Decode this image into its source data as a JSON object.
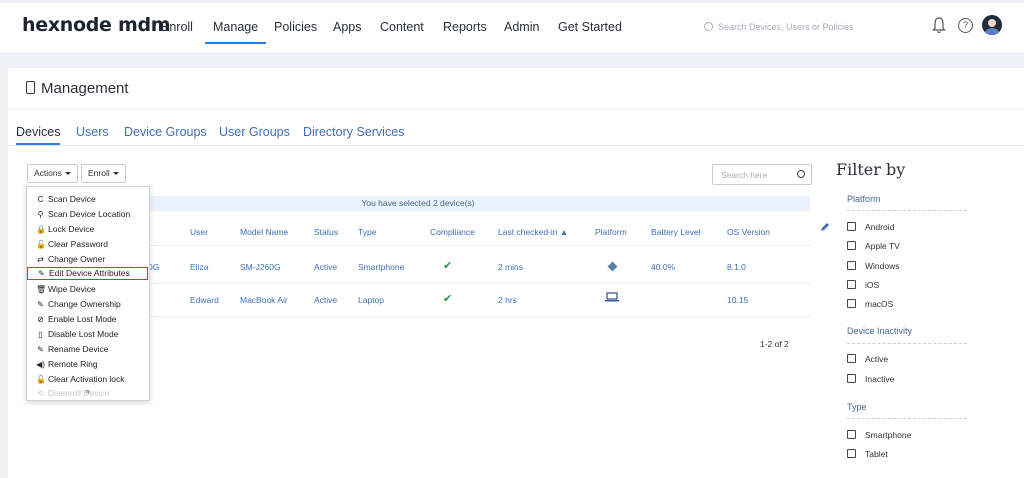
{
  "nav": {
    "logo": "hexnode mdm",
    "items": [
      "Enroll",
      "Manage",
      "Policies",
      "Apps",
      "Content",
      "Reports",
      "Admin",
      "Get Started"
    ],
    "active": "Manage",
    "search_placeholder": "Search Devices, Users or Policies"
  },
  "page": {
    "title": "Management",
    "tabs": [
      "Devices",
      "Users",
      "Device Groups",
      "User Groups",
      "Directory Services"
    ],
    "active_tab": "Devices"
  },
  "toolbar": {
    "actions_label": "Actions",
    "enroll_label": "Enroll",
    "search_placeholder": "Search here"
  },
  "table": {
    "banner": "You have selected 2 device(s)",
    "columns": [
      "User",
      "Model Name",
      "Status",
      "Type",
      "Compliance",
      "Last checked-in ▲",
      "Platform",
      "Battery Level",
      "OS Version"
    ],
    "rows": [
      {
        "name_fragment": "0G",
        "user": "Eliza",
        "model": "SM-J260G",
        "status": "Active",
        "type": "Smartphone",
        "compliance": "✔",
        "last_checked": "2 mins",
        "platform": "android-icon",
        "battery": "40.0%",
        "os": "8.1.0"
      },
      {
        "name_fragment": "",
        "user": "Edward",
        "model": "MacBook Air",
        "status": "Active",
        "type": "Laptop",
        "compliance": "✔",
        "last_checked": "2 hrs",
        "platform": "laptop-icon",
        "battery": "",
        "os": "10.15"
      }
    ],
    "pager": "1-2 of 2"
  },
  "actions_menu": {
    "items": [
      {
        "icon": "C",
        "label": "Scan Device"
      },
      {
        "icon": "⚲",
        "label": "Scan Device Location"
      },
      {
        "icon": "🔒",
        "label": "Lock Device"
      },
      {
        "icon": "🔓",
        "label": "Clear Password"
      },
      {
        "icon": "⇄",
        "label": "Change Owner"
      },
      {
        "icon": "✎",
        "label": "Edit Device Attributes"
      },
      {
        "icon": "🗑",
        "label": "Wipe Device"
      },
      {
        "icon": "✎",
        "label": "Change Ownership"
      },
      {
        "icon": "⊘",
        "label": "Enable Lost Mode"
      },
      {
        "icon": "▯",
        "label": "Disable Lost Mode"
      },
      {
        "icon": "✎",
        "label": "Rename Device"
      },
      {
        "icon": "◀)",
        "label": "Remote Ring"
      },
      {
        "icon": "🔓",
        "label": "Clear Activation lock"
      },
      {
        "icon": "⟲",
        "label": "Disenroll Device"
      }
    ],
    "highlighted": "Edit Device Attributes"
  },
  "filter": {
    "title": "Filter by",
    "sections": [
      {
        "name": "Platform",
        "options": [
          "Android",
          "Apple TV",
          "Windows",
          "iOS",
          "macOS"
        ]
      },
      {
        "name": "Device Inactivity",
        "options": [
          "Active",
          "Inactive"
        ]
      },
      {
        "name": "Type",
        "options": [
          "Smartphone",
          "Tablet"
        ]
      }
    ]
  },
  "colors": {
    "accent": "#2a7de1",
    "link": "#3f6fb5",
    "highlight_border": "#d9342b",
    "check": "#2f8f3f"
  }
}
